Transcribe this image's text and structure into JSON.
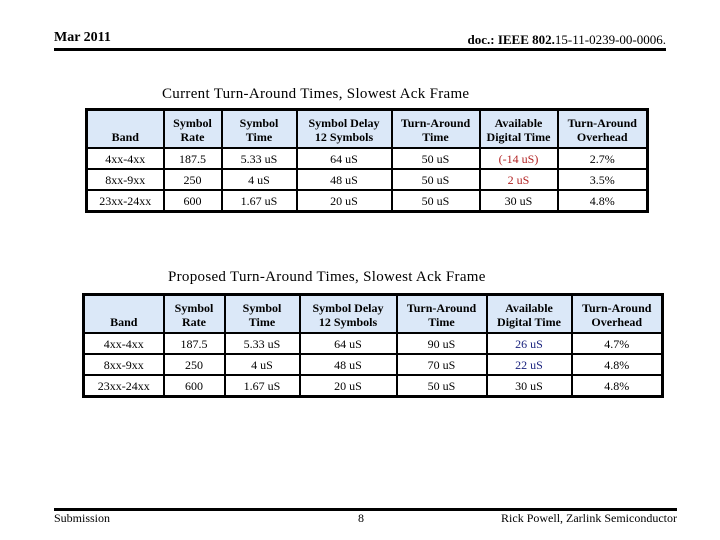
{
  "header": {
    "date": "Mar 2011",
    "doc_prefix": "doc.: IEEE 802.",
    "doc_number": "15-11-0239-00-0006."
  },
  "current_table": {
    "title": "Current Turn-Around Times, Slowest Ack Frame",
    "columns": [
      "Band",
      "Symbol Rate",
      "Symbol Time",
      "Symbol Delay 12 Symbols",
      "Turn-Around Time",
      "Available Digital Time",
      "Turn-Around Overhead"
    ],
    "header_lines": [
      [
        "Band"
      ],
      [
        "Symbol",
        "Rate"
      ],
      [
        "Symbol",
        "Time"
      ],
      [
        "Symbol Delay",
        "12 Symbols"
      ],
      [
        "Turn-Around",
        "Time"
      ],
      [
        "Available",
        "Digital Time"
      ],
      [
        "Turn-Around",
        "Overhead"
      ]
    ],
    "rows": [
      [
        "4xx-4xx",
        "187.5",
        "5.33 uS",
        "64 uS",
        "50 uS",
        "(-14 uS)",
        "2.7%"
      ],
      [
        "8xx-9xx",
        "250",
        "4 uS",
        "48 uS",
        "50 uS",
        "2 uS",
        "3.5%"
      ],
      [
        "23xx-24xx",
        "600",
        "1.67 uS",
        "20 uS",
        "50 uS",
        "30 uS",
        "4.8%"
      ]
    ],
    "highlight_color": "#b22222"
  },
  "proposed_table": {
    "title": "Proposed Turn-Around Times, Slowest Ack Frame",
    "header_lines": [
      [
        "Band"
      ],
      [
        "Symbol",
        "Rate"
      ],
      [
        "Symbol",
        "Time"
      ],
      [
        "Symbol Delay",
        "12 Symbols"
      ],
      [
        "Turn-Around",
        "Time"
      ],
      [
        "Available",
        "Digital Time"
      ],
      [
        "Turn-Around",
        "Overhead"
      ]
    ],
    "rows": [
      [
        "4xx-4xx",
        "187.5",
        "5.33 uS",
        "64 uS",
        "90 uS",
        "26 uS",
        "4.7%"
      ],
      [
        "8xx-9xx",
        "250",
        "4 uS",
        "48 uS",
        "70 uS",
        "22 uS",
        "4.8%"
      ],
      [
        "23xx-24xx",
        "600",
        "1.67 uS",
        "20 uS",
        "50 uS",
        "30 uS",
        "4.8%"
      ]
    ],
    "highlight_color": "#1a237e"
  },
  "header_bg": "#dbe8f8",
  "footer": {
    "left": "Submission",
    "page": "8",
    "right": "Rick Powell, Zarlink Semiconductor"
  }
}
